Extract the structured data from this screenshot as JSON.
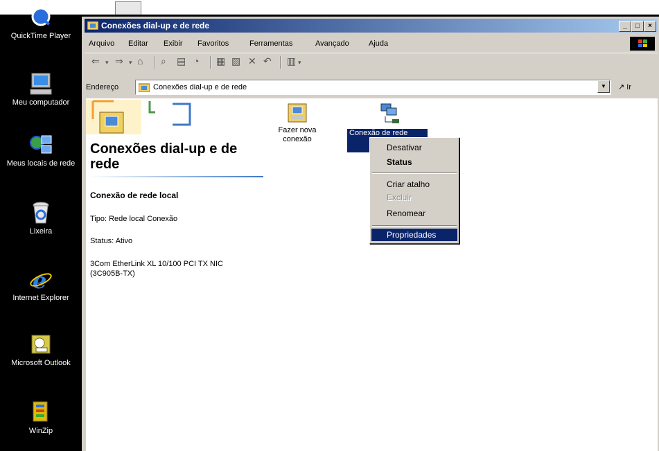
{
  "top_strip": {
    "caption": ""
  },
  "desktop": {
    "icons": [
      {
        "label": "QuickTime Player",
        "icon": "quicktime-icon"
      },
      {
        "label": "Meu computador",
        "icon": "my-computer-icon"
      },
      {
        "label": "Meus locais de rede",
        "icon": "network-places-icon"
      },
      {
        "label": "Lixeira",
        "icon": "recycle-bin-icon"
      },
      {
        "label": "Internet Explorer",
        "icon": "internet-explorer-icon"
      },
      {
        "label": "Microsoft Outlook",
        "icon": "outlook-icon"
      },
      {
        "label": "WinZip",
        "icon": "winzip-icon"
      }
    ]
  },
  "window": {
    "title": "Conexões dial-up e de rede",
    "controls": {
      "minimize": "_",
      "maximize": "□",
      "close": "×"
    },
    "menu": [
      "Arquivo",
      "Editar",
      "Exibir",
      "Favoritos",
      "Ferramentas",
      "Avançado",
      "Ajuda"
    ],
    "address": {
      "label": "Endereço",
      "value": "Conexões dial-up e de rede",
      "go": "Ir"
    },
    "panel": {
      "heading": "Conexões dial-up e de rede",
      "section": "Conexão de rede local",
      "type": "Tipo: Rede local Conexão",
      "status": "Status: Ativo",
      "adapter": "3Com EtherLink XL 10/100 PCI TX NIC (3C905B-TX)"
    },
    "items": [
      {
        "label": "Fazer nova conexão",
        "icon": "new-connection-icon"
      },
      {
        "label": "Conexão de rede",
        "icon": "network-connection-icon",
        "selected": true
      }
    ]
  },
  "context_menu": {
    "items": [
      {
        "label": "Desativar",
        "state": "normal"
      },
      {
        "label": "Status",
        "state": "bold"
      },
      {
        "label": "Criar atalho",
        "state": "normal"
      },
      {
        "label": "Excluir",
        "state": "disabled"
      },
      {
        "label": "Renomear",
        "state": "normal"
      },
      {
        "label": "Propriedades",
        "state": "highlighted"
      }
    ]
  },
  "colors": {
    "title_start": "#0a246a",
    "title_end": "#a6caf0",
    "highlight": "#0a246a",
    "face": "#d4d0c8"
  }
}
